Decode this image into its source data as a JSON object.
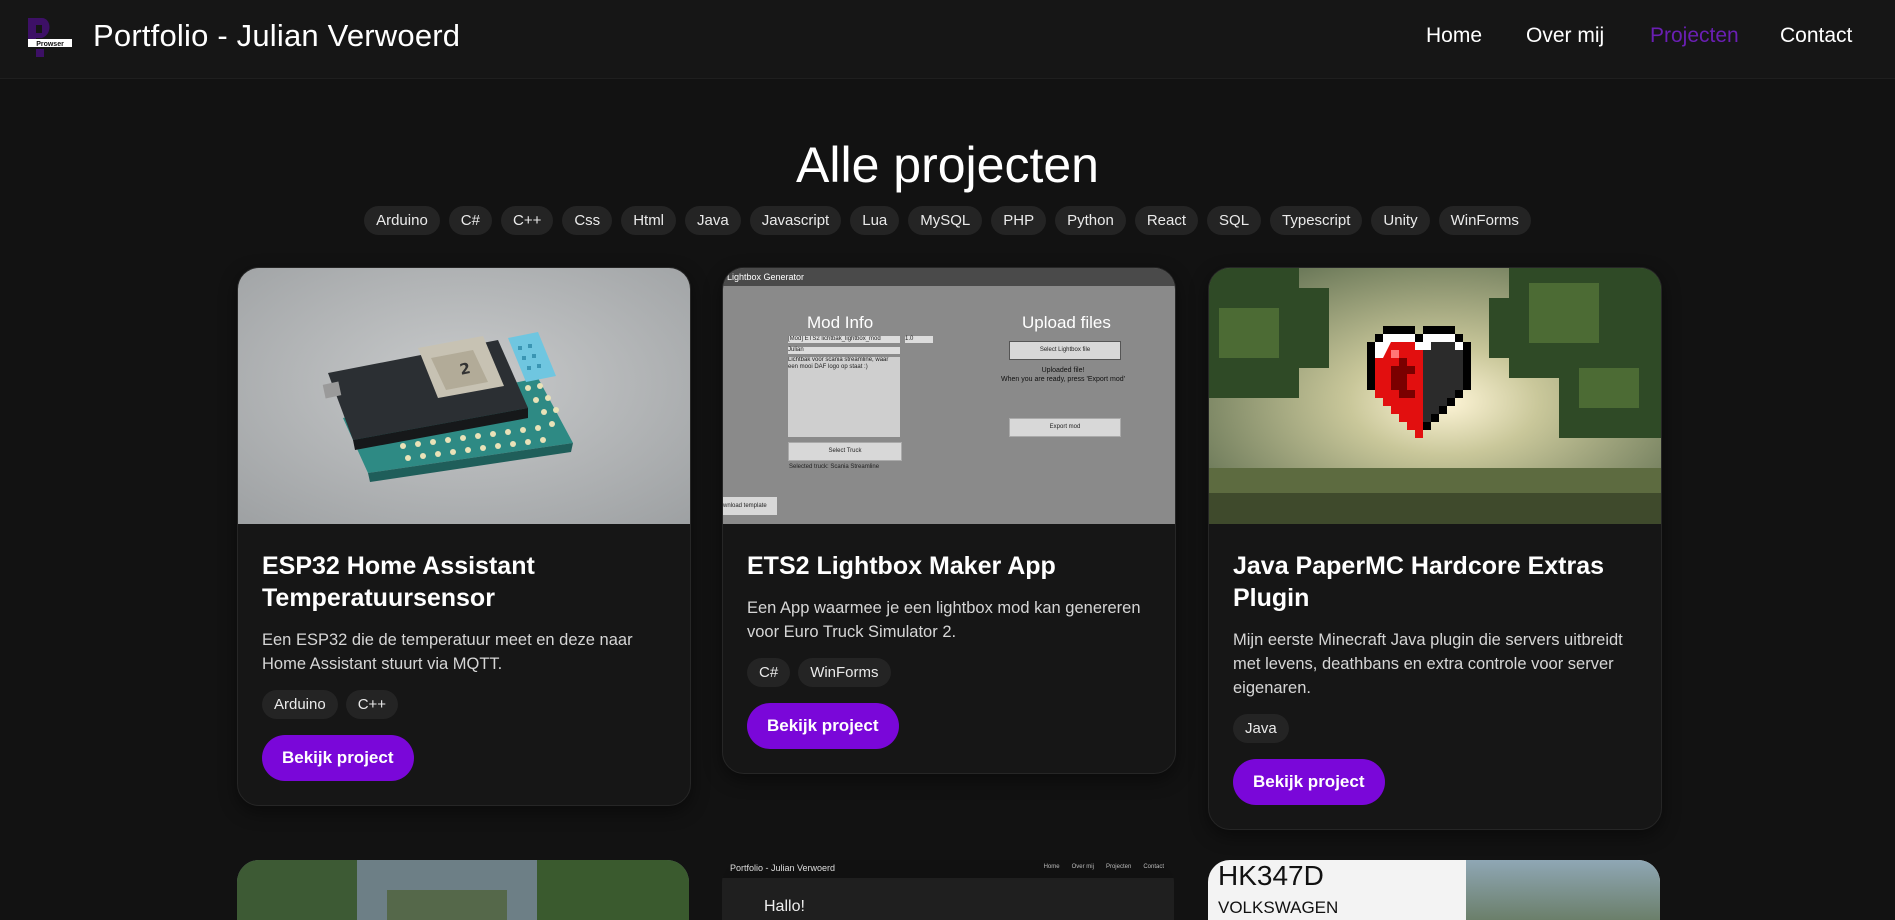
{
  "header": {
    "logo_text": "Prowser",
    "brand": "Portfolio - Julian Verwoerd",
    "nav": [
      {
        "label": "Home"
      },
      {
        "label": "Over mij"
      },
      {
        "label": "Projecten",
        "active": true
      },
      {
        "label": "Contact"
      }
    ]
  },
  "page": {
    "title": "Alle projecten",
    "filters": [
      "Arduino",
      "C#",
      "C++",
      "Css",
      "Html",
      "Java",
      "Javascript",
      "Lua",
      "MySQL",
      "PHP",
      "Python",
      "React",
      "SQL",
      "Typescript",
      "Unity",
      "WinForms"
    ]
  },
  "projects": [
    {
      "title": "ESP32 Home Assistant Temperatuursensor",
      "description": "Een ESP32 die de temperatuur meet en deze naar Home Assistant stuurt via MQTT.",
      "tags": [
        "Arduino",
        "C++"
      ],
      "button": "Bekijk project",
      "board_label": "2"
    },
    {
      "title": "ETS2 Lightbox Maker App",
      "description": "Een App waarmee je een lightbox mod kan genereren voor Euro Truck Simulator 2.",
      "tags": [
        "C#",
        "WinForms"
      ],
      "button": "Bekijk project",
      "screenshot": {
        "window_title": "Lightbox Generator",
        "mod_info_title": "Mod Info",
        "mod_name": "[Mod] ETS2 lichtbak_lightbox_mod",
        "mod_version": "1.0",
        "author": "Julian",
        "mod_desc": "Lichtbak voor scania streamline, waar een mooi DAF logo op staat :)",
        "select_truck": "Select Truck",
        "selected_truck": "Selected truck: Scania Streamline",
        "upload_title": "Upload files",
        "select_file": "Select Lightbox file",
        "uploaded": "Uploaded file!",
        "ready_msg": "When you are ready, press 'Export mod'",
        "export": "Export mod",
        "download": "wnload template"
      }
    },
    {
      "title": "Java PaperMC Hardcore Extras Plugin",
      "description": "Mijn eerste Minecraft Java plugin die servers uitbreidt met levens, deathbans en extra controle voor server eigenaren.",
      "tags": [
        "Java"
      ],
      "button": "Bekijk project"
    }
  ],
  "partial": {
    "portfolio_preview": {
      "title": "Portfolio - Julian Verwoerd",
      "nav": [
        "Home",
        "Over mij",
        "Projecten",
        "Contact"
      ],
      "hello": "Hallo!"
    },
    "plate": {
      "number": "HK347D",
      "make": "VOLKSWAGEN"
    }
  },
  "colors": {
    "accent": "#7a07d9",
    "active_nav": "#6a1fb3",
    "background": "#121212"
  }
}
